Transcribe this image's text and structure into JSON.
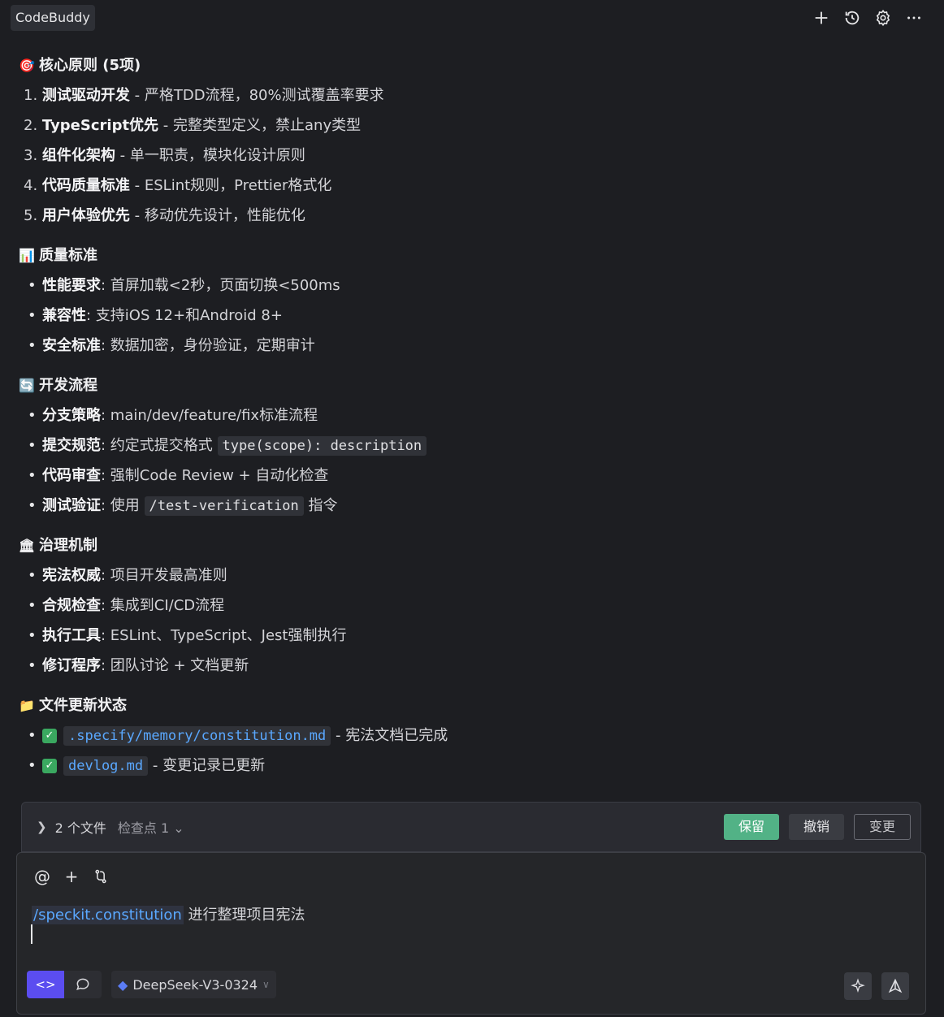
{
  "app": {
    "title": "CodeBuddy"
  },
  "toolbar": {
    "new_icon": "plus-icon",
    "history_icon": "history-icon",
    "settings_icon": "gear-icon",
    "more_icon": "more-icon"
  },
  "sections": {
    "principles": {
      "emoji": "🎯",
      "title": "核心原则 (5项)",
      "items": [
        {
          "num": "1.",
          "bold": "测试驱动开发",
          "text": " - 严格TDD流程，80%测试覆盖率要求"
        },
        {
          "num": "2.",
          "bold": "TypeScript优先",
          "text": " - 完整类型定义，禁止any类型"
        },
        {
          "num": "3.",
          "bold": "组件化架构",
          "text": " - 单一职责，模块化设计原则"
        },
        {
          "num": "4.",
          "bold": "代码质量标准",
          "text": " - ESLint规则，Prettier格式化"
        },
        {
          "num": "5.",
          "bold": "用户体验优先",
          "text": " - 移动优先设计，性能优化"
        }
      ]
    },
    "quality": {
      "emoji": "📊",
      "title": "质量标准",
      "items": [
        {
          "bold": "性能要求",
          "text": ": 首屏加载<2秒，页面切换<500ms"
        },
        {
          "bold": "兼容性",
          "text": ": 支持iOS 12+和Android 8+"
        },
        {
          "bold": "安全标准",
          "text": ": 数据加密，身份验证，定期审计"
        }
      ]
    },
    "workflow": {
      "emoji": "🔄",
      "title": "开发流程",
      "items": [
        {
          "bold": "分支策略",
          "text": ": main/dev/feature/fix标准流程"
        },
        {
          "bold": "提交规范",
          "text": ": 约定式提交格式 ",
          "code": "type(scope): description",
          "after": ""
        },
        {
          "bold": "代码审查",
          "text": ": 强制Code Review + 自动化检查"
        },
        {
          "bold": "测试验证",
          "text": ": 使用 ",
          "code": "/test-verification",
          "after": " 指令"
        }
      ]
    },
    "governance": {
      "emoji": "🏛",
      "title": "治理机制",
      "items": [
        {
          "bold": "宪法权威",
          "text": ": 项目开发最高准则"
        },
        {
          "bold": "合规检查",
          "text": ": 集成到CI/CD流程"
        },
        {
          "bold": "执行工具",
          "text": ": ESLint、TypeScript、Jest强制执行"
        },
        {
          "bold": "修订程序",
          "text": ": 团队讨论 + 文档更新"
        }
      ]
    },
    "files": {
      "emoji": "📁",
      "title": "文件更新状态",
      "items": [
        {
          "check": "✓",
          "path": ".specify/memory/constitution.md",
          "text": " - 宪法文档已完成"
        },
        {
          "check": "✓",
          "path": "devlog.md",
          "text": " - 变更记录已更新"
        }
      ]
    }
  },
  "changes": {
    "files_label": "2 个文件",
    "checkpoint_label": "检查点 1",
    "keep": "保留",
    "undo": "撤销",
    "change": "变更"
  },
  "input": {
    "command": "/speckit.constitution",
    "text": " 进行整理项目宪法",
    "model": "DeepSeek-V3-0324"
  }
}
